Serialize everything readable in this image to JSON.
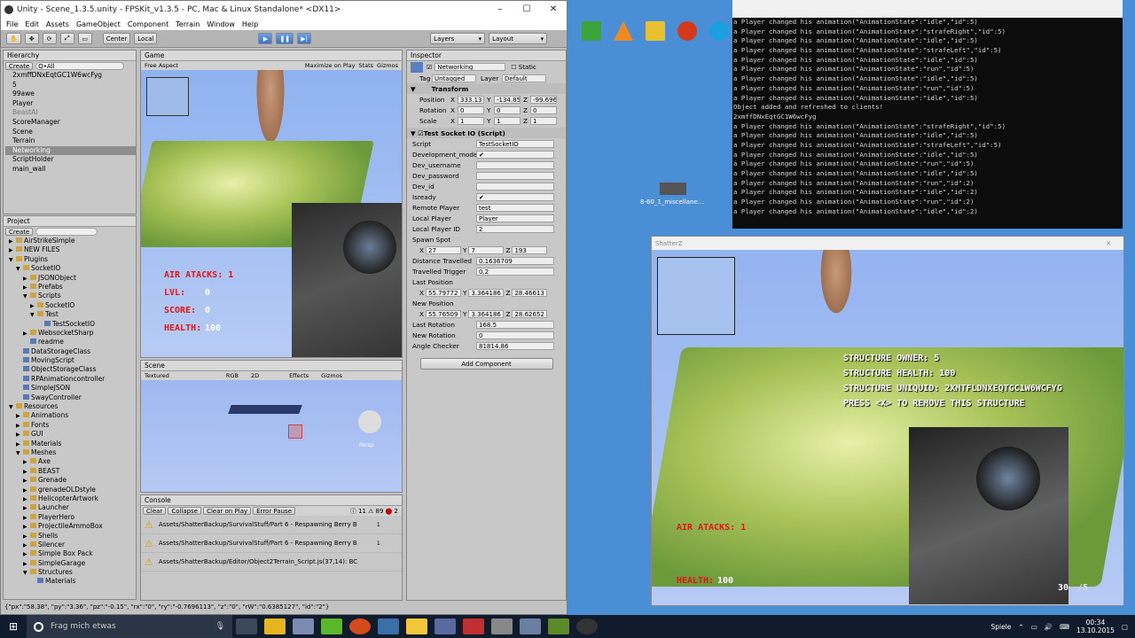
{
  "unity": {
    "title": "Unity - Scene_1.3.5.unity - FPSKit_v1.3.5 - PC, Mac & Linux Standalone* <DX11>",
    "win_controls": [
      "–",
      "☐",
      "✕"
    ],
    "menu": [
      "File",
      "Edit",
      "Assets",
      "GameObject",
      "Component",
      "Terrain",
      "Window",
      "Help"
    ],
    "toolbar": {
      "center": "Center",
      "local": "Local",
      "layers": "Layers",
      "layout": "Layout"
    },
    "hierarchy": {
      "tab": "Hierarchy",
      "create": "Create",
      "search": "Q•All",
      "items": [
        "2xmffDNxEqtGC1W6wcFyg",
        "5",
        "99awe",
        "Player",
        "BeastAI",
        "ScoreManager",
        "Scene",
        "Terrain",
        "Networking",
        "ScriptHolder",
        "main_wall"
      ]
    },
    "game": {
      "tab": "Game",
      "aspect": "Free Aspect",
      "maximize": "Maximize on Play",
      "stats": "Stats",
      "gizmos": "Gizmos",
      "hud": {
        "air": "AIR ATACKS: 1",
        "lvl_l": "LVL:",
        "lvl_v": "0",
        "score_l": "SCORE:",
        "score_v": "0",
        "health_l": "HEALTH:",
        "health_v": "100"
      }
    },
    "project": {
      "tab": "Project",
      "create": "Create",
      "items": [
        {
          "t": "AirStrikeSimple",
          "d": 0,
          "f": "▶"
        },
        {
          "t": "NEW FILES",
          "d": 0,
          "f": "▶"
        },
        {
          "t": "Plugins",
          "d": 0,
          "f": "▼"
        },
        {
          "t": "SocketIO",
          "d": 1,
          "f": "▼"
        },
        {
          "t": "JSONObject",
          "d": 2,
          "f": "▶"
        },
        {
          "t": "Prefabs",
          "d": 2,
          "f": "▶"
        },
        {
          "t": "Scripts",
          "d": 2,
          "f": "▼"
        },
        {
          "t": "SocketIO",
          "d": 3,
          "f": "▶"
        },
        {
          "t": "Test",
          "d": 3,
          "f": "▼"
        },
        {
          "t": "TestSocketIO",
          "d": 4,
          "f": ""
        },
        {
          "t": "WebsocketSharp",
          "d": 2,
          "f": "▶"
        },
        {
          "t": "readme",
          "d": 2,
          "f": ""
        },
        {
          "t": "DataStorageClass",
          "d": 1,
          "f": ""
        },
        {
          "t": "MovingScript",
          "d": 1,
          "f": ""
        },
        {
          "t": "ObjectStorageClass",
          "d": 1,
          "f": ""
        },
        {
          "t": "RPAnimationcontroller",
          "d": 1,
          "f": ""
        },
        {
          "t": "SimpleJSON",
          "d": 1,
          "f": ""
        },
        {
          "t": "SwayController",
          "d": 1,
          "f": ""
        },
        {
          "t": "Resources",
          "d": 0,
          "f": "▼"
        },
        {
          "t": "Animations",
          "d": 1,
          "f": "▶"
        },
        {
          "t": "Fonts",
          "d": 1,
          "f": "▶"
        },
        {
          "t": "GUI",
          "d": 1,
          "f": "▶"
        },
        {
          "t": "Materials",
          "d": 1,
          "f": "▶"
        },
        {
          "t": "Meshes",
          "d": 1,
          "f": "▼"
        },
        {
          "t": "Axe",
          "d": 2,
          "f": "▶"
        },
        {
          "t": "BEAST",
          "d": 2,
          "f": "▶"
        },
        {
          "t": "Grenade",
          "d": 2,
          "f": "▶"
        },
        {
          "t": "grenadeOLDstyle",
          "d": 2,
          "f": "▶"
        },
        {
          "t": "HelicopterArtwork",
          "d": 2,
          "f": "▶"
        },
        {
          "t": "Launcher",
          "d": 2,
          "f": "▶"
        },
        {
          "t": "PlayerHero",
          "d": 2,
          "f": "▶"
        },
        {
          "t": "ProjectileAmmoBox",
          "d": 2,
          "f": "▶"
        },
        {
          "t": "Shells",
          "d": 2,
          "f": "▶"
        },
        {
          "t": "Silencer",
          "d": 2,
          "f": "▶"
        },
        {
          "t": "Simple Box Pack",
          "d": 2,
          "f": "▶"
        },
        {
          "t": "SimpleGarage",
          "d": 2,
          "f": "▶"
        },
        {
          "t": "Structures",
          "d": 2,
          "f": "▼"
        },
        {
          "t": "Materials",
          "d": 3,
          "f": ""
        }
      ]
    },
    "scene": {
      "tab": "Scene",
      "shading": "Textured",
      "rgb": "RGB",
      "mode2d": "2D",
      "effects": "Effects",
      "gizmos": "Gizmos",
      "persp": "Persp"
    },
    "console": {
      "tab": "Console",
      "buttons": [
        "Clear",
        "Collapse",
        "Clear on Play",
        "Error Pause"
      ],
      "count_info": "11",
      "count_warn": "89",
      "count_err": "2",
      "lines": [
        "Assets/ShatterBackup/SurvivalStuff/Part 6 - Respawning Berry B",
        "Assets/ShatterBackup/SurvivalStuff/Part 6 - Respawning Berry B",
        "Assets/ShatterBackup/Editor/Object2Terrain_Script.js(37,14): BC"
      ],
      "badges": [
        "1",
        "1",
        ""
      ]
    },
    "inspector": {
      "tab": "Inspector",
      "object_name": "Networking",
      "static": "Static",
      "tag_l": "Tag",
      "tag": "Untagged",
      "layer_l": "Layer",
      "layer": "Default",
      "transform": "Transform",
      "pos": [
        "Position",
        "X",
        "333.13",
        "Y",
        "-134.85",
        "Z",
        "-99.696"
      ],
      "rot": [
        "Rotation",
        "X",
        "0",
        "Y",
        "0",
        "Z",
        "0"
      ],
      "scale": [
        "Scale",
        "X",
        "1",
        "Y",
        "1",
        "Z",
        "1"
      ],
      "script_header": "Test Socket IO (Script)",
      "fields": [
        {
          "l": "Script",
          "v": "TestSocketIO"
        },
        {
          "l": "Development_mode",
          "v": "✔"
        },
        {
          "l": "Dev_username",
          "v": ""
        },
        {
          "l": "Dev_password",
          "v": ""
        },
        {
          "l": "Dev_id",
          "v": ""
        },
        {
          "l": "Isready",
          "v": "✔"
        },
        {
          "l": "Remote Player",
          "v": "test"
        },
        {
          "l": "Local Player",
          "v": "Player"
        },
        {
          "l": "Local Player ID",
          "v": "2"
        }
      ],
      "spawn": {
        "l": "Spawn Spot",
        "x": "27",
        "y": "7",
        "z": "193"
      },
      "fields2": [
        {
          "l": "Distance Travelled",
          "v": "0.1636709"
        },
        {
          "l": "Travelled Trigger",
          "v": "0.2"
        }
      ],
      "lastpos": {
        "l": "Last Position",
        "x": "55.79772",
        "y": "3.364186",
        "z": "28.46613"
      },
      "newpos": {
        "l": "New Position",
        "x": "55.76509",
        "y": "3.364186",
        "z": "28.62652"
      },
      "fields3": [
        {
          "l": "Last Rotation",
          "v": "168.5"
        },
        {
          "l": "New Rotation",
          "v": "0"
        },
        {
          "l": "Angle Checker",
          "v": "81814.86"
        }
      ],
      "add_component": "Add Component"
    },
    "status": "{\"px\":\"58.38\", \"py\":\"3.36\", \"pz\":\"-0.15\", \"rx\":\"0\", \"ry\":\"-0.7696113\", \"z\":\"0\", \"rW\":\"0.6385127\", \"id\":\"2\"}"
  },
  "desktop": {
    "icon_label": "8-60_1_miscellane..."
  },
  "cmd": {
    "lines": [
      "a Player changed his animation(\"AnimationState\":\"idle\",\"id\":5)",
      "a Player changed his animation(\"AnimationState\":\"strafeRight\",\"id\":5)",
      "a Player changed his animation(\"AnimationState\":\"idle\",\"id\":5)",
      "a Player changed his animation(\"AnimationState\":\"strafeLeft\",\"id\":5)",
      "a Player changed his animation(\"AnimationState\":\"idle\",\"id\":5)",
      "a Player changed his animation(\"AnimationState\":\"run\",\"id\":5)",
      "a Player changed his animation(\"AnimationState\":\"idle\",\"id\":5)",
      "a Player changed his animation(\"AnimationState\":\"run\",\"id\":5)",
      "a Player changed his animation(\"AnimationState\":\"idle\",\"id\":5)",
      "Object added and refreshed to clients!",
      "2xmffDNxEqtGC1W6wcFyg",
      "a Player changed his animation(\"AnimationState\":\"strafeRight\",\"id\":5)",
      "a Player changed his animation(\"AnimationState\":\"idle\",\"id\":5)",
      "a Player changed his animation(\"AnimationState\":\"strafeLeft\",\"id\":5)",
      "a Player changed his animation(\"AnimationState\":\"idle\",\"id\":5)",
      "a Player changed his animation(\"AnimationState\":\"run\",\"id\":5)",
      "a Player changed his animation(\"AnimationState\":\"idle\",\"id\":5)",
      "a Player changed his animation(\"AnimationState\":\"run\",\"id\":2)",
      "a Player changed his animation(\"AnimationState\":\"idle\",\"id\":2)",
      "a Player changed his animation(\"AnimationState\":\"run\",\"id\":2)",
      "a Player changed his animation(\"AnimationState\":\"idle\",\"id\":2)"
    ]
  },
  "shatter": {
    "title": "ShatterZ",
    "structure": [
      "STRUCTURE OWNER: 5",
      "STRUCTURE HEALTH: 100",
      "STRUCTURE UNIQUID: 2XMTFLDNXEQTGC1W6WCFYG",
      "PRESS <X> TO REMOVE THIS STRUCTURE"
    ],
    "air": "AIR ATACKS: 1",
    "health_l": "HEALTH:",
    "health_v": "100",
    "ammo": "30",
    "ammo_total": "/5"
  },
  "taskbar": {
    "search": "Frag mich etwas",
    "games": "Spiele",
    "time": "00:34",
    "date": "13.10.2015"
  }
}
